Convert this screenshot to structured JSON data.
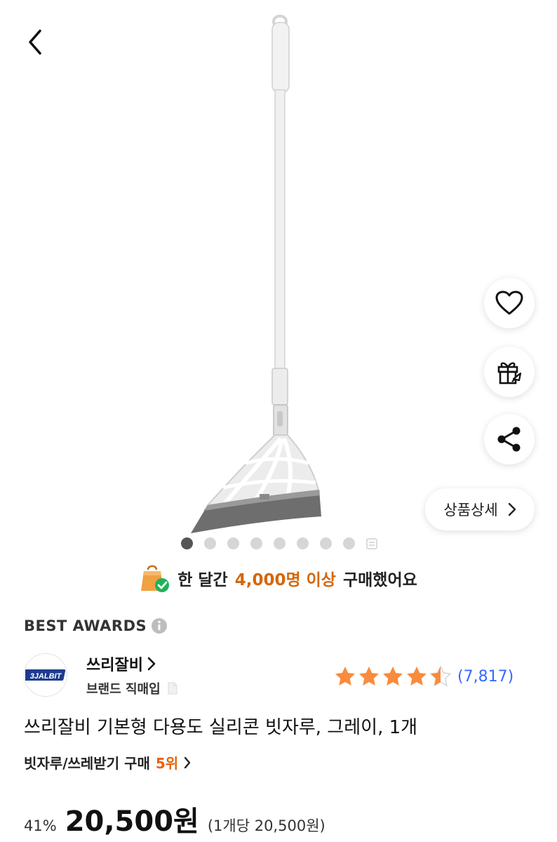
{
  "nav": {
    "back_icon": "chevron-left-icon"
  },
  "product_image": {
    "alt": "icon-broom"
  },
  "floating_actions": {
    "wishlist_icon": "heart-icon",
    "gift_icon": "gift-icon",
    "share_icon": "share-icon",
    "detail_label": "상품상세"
  },
  "carousel": {
    "total_dots": 8,
    "active_index": 0
  },
  "purchase_banner": {
    "prefix": "한 달간",
    "highlight": "4,000명 이상",
    "suffix": "구매했어요"
  },
  "awards": {
    "label": "BEST AWARDS"
  },
  "brand": {
    "logo_text": "3JALBIT",
    "name": "쓰리잘비",
    "sub_label": "브랜드 직매입"
  },
  "rating": {
    "score": 4.5,
    "max": 5,
    "review_count": "(7,817)"
  },
  "product": {
    "title": "쓰리잘비 기본형 다용도 실리콘 빗자루, 그레이, 1개",
    "rank_category": "빗자루/쓰레받기 구매",
    "rank_value": "5위"
  },
  "price": {
    "discount": "41%",
    "amount": "20,500원",
    "unit_price": "(1개당 20,500원)"
  },
  "colors": {
    "accent_orange": "#d4670c",
    "star": "#f98b3d",
    "link_blue": "#346aff"
  }
}
